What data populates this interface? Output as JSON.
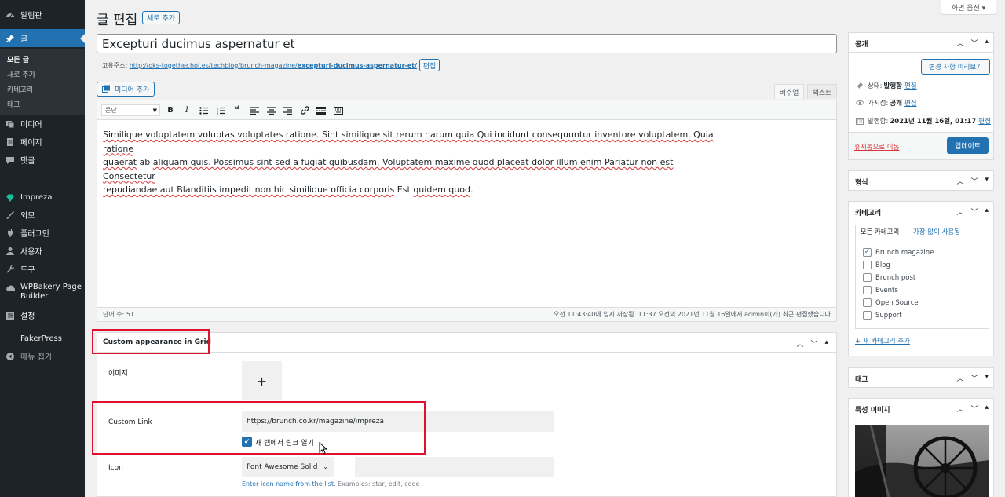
{
  "sidebar": {
    "items": [
      {
        "label": "알림판",
        "icon": "dashboard-icon"
      },
      {
        "label": "글",
        "icon": "pin-icon"
      },
      {
        "label": "미디어",
        "icon": "media-icon"
      },
      {
        "label": "페이지",
        "icon": "page-icon"
      },
      {
        "label": "댓글",
        "icon": "comment-icon"
      },
      {
        "label": "Impreza",
        "icon": "diamond-icon"
      },
      {
        "label": "외모",
        "icon": "brush-icon"
      },
      {
        "label": "플러그인",
        "icon": "plugin-icon"
      },
      {
        "label": "사용자",
        "icon": "user-icon"
      },
      {
        "label": "도구",
        "icon": "wrench-icon"
      },
      {
        "label": "WPBakery Page Builder",
        "icon": "wpbakery-icon"
      },
      {
        "label": "설정",
        "icon": "settings-icon"
      },
      {
        "label": "FakerPress",
        "icon": ""
      },
      {
        "label": "메뉴 접기",
        "icon": "collapse-icon"
      }
    ],
    "submenu": [
      "모든 글",
      "새로 추가",
      "카테고리",
      "태그"
    ]
  },
  "header": {
    "title": "글 편집",
    "add_new": "새로 추가",
    "screen_options": "화면 옵션 ▾"
  },
  "post": {
    "title": "Excepturi ducimus aspernatur et",
    "permalink_label": "고유주소:",
    "permalink_base": "http://oks-together.hol.es/techblog/brunch-magazine/",
    "permalink_slug": "excepturi-ducimus-aspernatur-et/",
    "permalink_edit": "편집"
  },
  "editor": {
    "add_media": "미디어 추가",
    "tab_visual": "비주얼",
    "tab_text": "텍스트",
    "format": "문단",
    "content_lines": [
      [
        [
          "Similique voluptatem voluptas voluptates ratione. Sint similique sit rerum harum quia Qui incidunt consequuntur inventore voluptatem. Quia ratione",
          true
        ]
      ],
      [
        [
          "quaerat",
          true
        ],
        [
          " ab ",
          false
        ],
        [
          "aliquam quis. Possimus sint sed a fugiat quibusdam. Voluptatem maxime quod placeat dolor illum enim Pariatur non est Consectetur",
          true
        ]
      ],
      [
        [
          "repudiandae aut Blanditiis impedit non hic similique officia corporis",
          true
        ],
        [
          " Est ",
          false
        ],
        [
          "quidem quod",
          true
        ],
        [
          ".",
          false
        ]
      ]
    ],
    "word_count": "단어 수: 51",
    "save_status": "오전 11:43:40에 임시 저장됨. 11:37 오전의 2021년 11월 16일에서 admin이(가) 최근 편집했습니다"
  },
  "custom_box": {
    "title": "Custom appearance in Grid",
    "image_label": "이미지",
    "link_label": "Custom Link",
    "link_value": "https://brunch.co.kr/magazine/impreza",
    "new_tab_label": "새 탭에서 링크 열기",
    "icon_label": "Icon",
    "icon_select": "Font Awesome Solid",
    "icon_hint_link": "Enter icon name from the list.",
    "icon_hint_rest": " Examples: star, edit, code"
  },
  "publish": {
    "title": "공개",
    "preview": "변경 사항 미리보기",
    "status_label": "상태:",
    "status_value": "발행함",
    "visibility_label": "가시성:",
    "visibility_value": "공개",
    "published_label": "발행함:",
    "published_value": "2021년 11월 16일, 01:17",
    "edit": "편집",
    "trash": "휴지통으로 이동",
    "update": "업데이트"
  },
  "format_box": {
    "title": "형식"
  },
  "category_box": {
    "title": "카테고리",
    "tab_all": "모든 카테고리",
    "tab_popular": "가장 많이 사용됨",
    "items": [
      {
        "label": "Brunch magazine",
        "checked": true
      },
      {
        "label": "Blog",
        "checked": false
      },
      {
        "label": "Brunch post",
        "checked": false
      },
      {
        "label": "Events",
        "checked": false
      },
      {
        "label": "Open Source",
        "checked": false
      },
      {
        "label": "Support",
        "checked": false
      }
    ],
    "add_new": "+ 새 카테고리 추가"
  },
  "tag_box": {
    "title": "태그"
  },
  "featured_box": {
    "title": "특성 이미지"
  },
  "colors": {
    "primary": "#2271b1",
    "sidebar": "#1d2327",
    "highlight": "#e0112b"
  }
}
